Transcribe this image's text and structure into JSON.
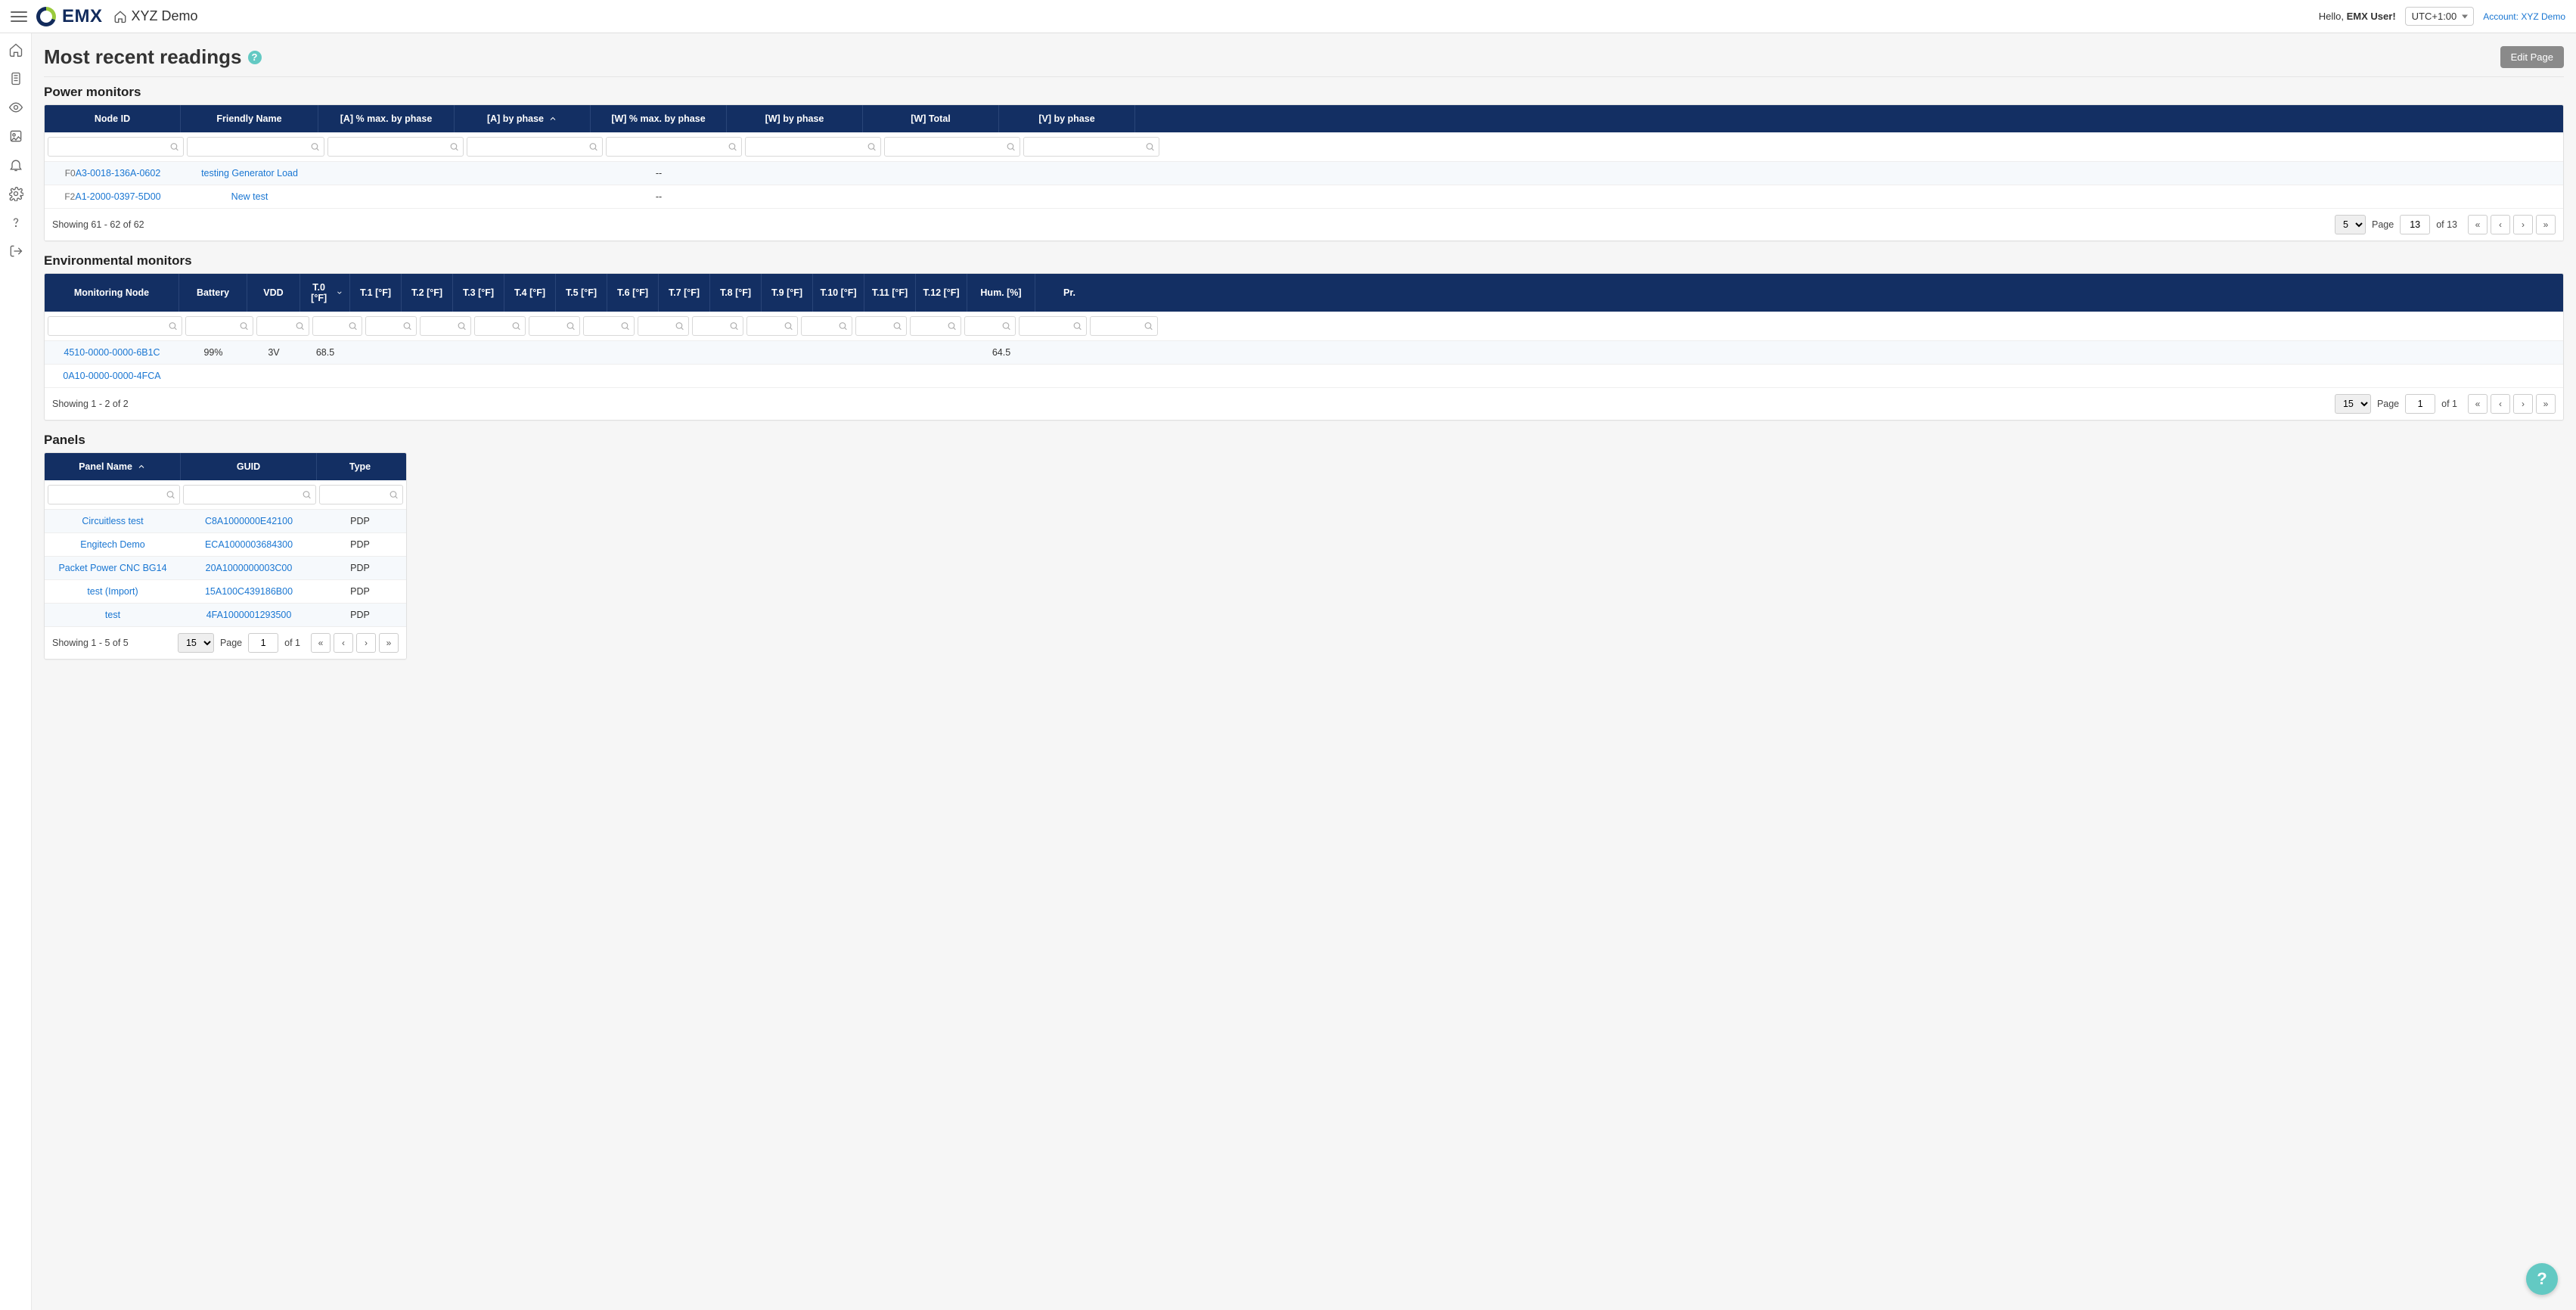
{
  "header": {
    "brand": "EMX",
    "home_label": "XYZ Demo",
    "greeting_prefix": "Hello, ",
    "greeting_name": "EMX User!",
    "timezone": "UTC+1:00",
    "account_prefix": "Account: ",
    "account_name": "XYZ Demo"
  },
  "page": {
    "title": "Most recent readings",
    "edit_button": "Edit Page"
  },
  "power": {
    "title": "Power monitors",
    "columns": [
      "Node ID",
      "Friendly Name",
      "[A] % max. by phase",
      "[A] by phase",
      "[W] % max. by phase",
      "[W] by phase",
      "[W] Total",
      "[V] by phase"
    ],
    "rows": [
      {
        "prefix": "F0",
        "node": "A3-0018-136A-0602",
        "name": "testing Generator Load",
        "w_pct": "--"
      },
      {
        "prefix": "F2",
        "node": "A1-2000-0397-5D00",
        "name": "New test",
        "w_pct": "--"
      }
    ],
    "footer": {
      "showing": "Showing 61 - 62 of 62",
      "page_size": "5",
      "page_label": "Page",
      "page": "13",
      "of_label": "of 13"
    }
  },
  "env": {
    "title": "Environmental monitors",
    "columns": [
      "Monitoring Node",
      "Battery",
      "VDD",
      "T.0 [°F]",
      "T.1 [°F]",
      "T.2 [°F]",
      "T.3 [°F]",
      "T.4 [°F]",
      "T.5 [°F]",
      "T.6 [°F]",
      "T.7 [°F]",
      "T.8 [°F]",
      "T.9 [°F]",
      "T.10 [°F]",
      "T.11 [°F]",
      "T.12 [°F]",
      "Hum. [%]",
      "Pr."
    ],
    "rows": [
      {
        "node": "4510-0000-0000-6B1C",
        "battery": "99%",
        "vdd": "3V",
        "t0": "68.5",
        "hum": "64.5"
      },
      {
        "node": "0A10-0000-0000-4FCA"
      }
    ],
    "footer": {
      "showing": "Showing 1 - 2 of 2",
      "page_size": "15",
      "page_label": "Page",
      "page": "1",
      "of_label": "of 1"
    }
  },
  "panels": {
    "title": "Panels",
    "columns": [
      "Panel Name",
      "GUID",
      "Type"
    ],
    "rows": [
      {
        "name": "Circuitless test",
        "guid": "C8A1000000E42100",
        "type": "PDP"
      },
      {
        "name": "Engitech Demo",
        "guid": "ECA1000003684300",
        "type": "PDP"
      },
      {
        "name": "Packet Power CNC BG14",
        "guid": "20A1000000003C00",
        "type": "PDP"
      },
      {
        "name": "test (Import)",
        "guid": "15A100C439186B00",
        "type": "PDP"
      },
      {
        "name": "test",
        "guid": "4FA1000001293500",
        "type": "PDP"
      }
    ],
    "footer": {
      "showing": "Showing 1 - 5 of 5",
      "page_size": "15",
      "page_label": "Page",
      "page": "1",
      "of_label": "of 1"
    }
  }
}
